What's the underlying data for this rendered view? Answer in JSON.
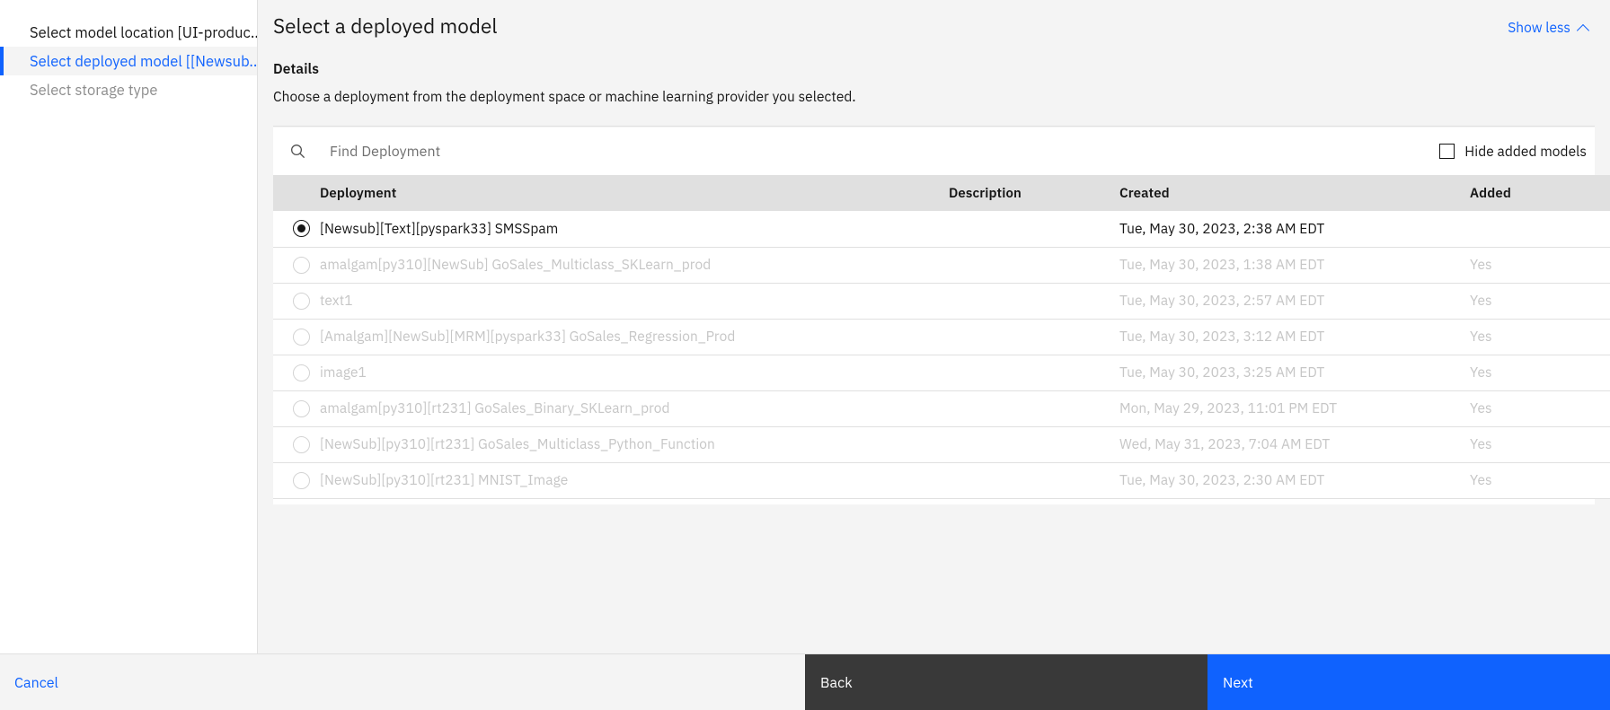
{
  "sidebar": {
    "items": [
      {
        "label": "Select model location [UI-produc...",
        "state": "done"
      },
      {
        "label": "Select deployed model [[Newsub...",
        "state": "current"
      },
      {
        "label": "Select storage type",
        "state": "upcoming"
      }
    ]
  },
  "header": {
    "title": "Select a deployed model",
    "show_less_label": "Show less",
    "chevron_icon": "chevron-up-icon"
  },
  "details": {
    "label": "Details",
    "description": "Choose a deployment from the deployment space or machine learning provider you selected."
  },
  "toolbar": {
    "search_icon": "search-icon",
    "search_value": "",
    "search_placeholder": "Find Deployment",
    "hide_added_label": "Hide added models",
    "hide_added_checked": false
  },
  "table": {
    "columns": [
      "",
      "Deployment",
      "Description",
      "Created",
      "Added"
    ],
    "rows": [
      {
        "selected": true,
        "disabled": false,
        "deployment": "[Newsub][Text][pyspark33] SMSSpam",
        "description": "",
        "created": "Tue, May 30, 2023, 2:38 AM EDT",
        "added": ""
      },
      {
        "selected": false,
        "disabled": true,
        "deployment": "amalgam[py310][NewSub] GoSales_Multiclass_SKLearn_prod",
        "description": "",
        "created": "Tue, May 30, 2023, 1:38 AM EDT",
        "added": "Yes"
      },
      {
        "selected": false,
        "disabled": true,
        "deployment": "text1",
        "description": "",
        "created": "Tue, May 30, 2023, 2:57 AM EDT",
        "added": "Yes"
      },
      {
        "selected": false,
        "disabled": true,
        "deployment": "[Amalgam][NewSub][MRM][pyspark33] GoSales_Regression_Prod",
        "description": "",
        "created": "Tue, May 30, 2023, 3:12 AM EDT",
        "added": "Yes"
      },
      {
        "selected": false,
        "disabled": true,
        "deployment": "image1",
        "description": "",
        "created": "Tue, May 30, 2023, 3:25 AM EDT",
        "added": "Yes"
      },
      {
        "selected": false,
        "disabled": true,
        "deployment": "amalgam[py310][rt231] GoSales_Binary_SKLearn_prod",
        "description": "",
        "created": "Mon, May 29, 2023, 11:01 PM EDT",
        "added": "Yes"
      },
      {
        "selected": false,
        "disabled": true,
        "deployment": "[NewSub][py310][rt231] GoSales_Multiclass_Python_Function",
        "description": "",
        "created": "Wed, May 31, 2023, 7:04 AM EDT",
        "added": "Yes"
      },
      {
        "selected": false,
        "disabled": true,
        "deployment": "[NewSub][py310][rt231] MNIST_Image",
        "description": "",
        "created": "Tue, May 30, 2023, 2:30 AM EDT",
        "added": "Yes"
      }
    ]
  },
  "footer": {
    "cancel_label": "Cancel",
    "back_label": "Back",
    "next_label": "Next"
  },
  "colors": {
    "accent": "#0f62fe",
    "back_button": "#393939",
    "page_bg": "#f4f4f4",
    "panel_bg": "#ffffff",
    "table_header_bg": "#e0e0e0",
    "disabled_text": "#c6c6c6"
  }
}
